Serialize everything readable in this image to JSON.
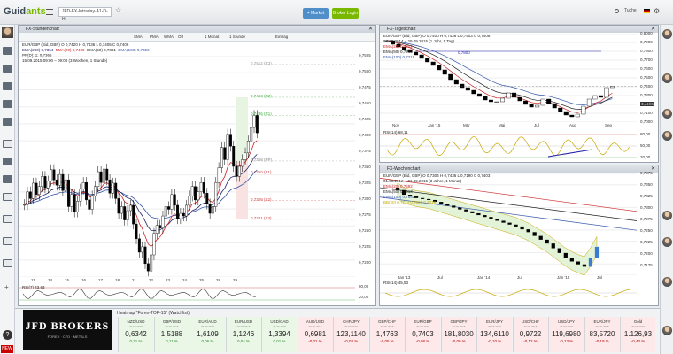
{
  "app": {
    "logo": "Guidants",
    "search_value": "JFD-FX-Intraday-A1-D-H",
    "btn_markt": "+ Market",
    "btn_broker": "Broker Login",
    "profile": "Tuche"
  },
  "chart1": {
    "title": "FX-Stundenchart",
    "toolbar": [
      "SMA",
      "PMA",
      "WMA",
      "Off",
      "1 Monat",
      "1 Stunde",
      "Eintrag"
    ],
    "legend": [
      "EUR/GBP (Bid, GBP)  O 0,7420  H 0,7436  L 0,7405  C 0,7406",
      "EMA(200) 0,7364",
      "EMA(20) 0,7405",
      "EMA(50) 0,7381",
      "EMA(100) 0,7356",
      "PP(D): 1: 0,7366",
      "15.09.2015 09:00 – 09:00 (3 Wochen, 1 Stunde)"
    ],
    "pivots": [
      "0,7512 (R3)",
      "0,7463 (R2)",
      "0,7436 (R1)",
      "0,7368 (PP)",
      "0,7350 (S1)",
      "0,7309 (S2)",
      "0,7281 (S3)"
    ],
    "yticks": [
      "0,7525",
      "0,7500",
      "0,7475",
      "0,7450",
      "0,7425",
      "0,7400",
      "0,7375",
      "0,7350",
      "0,7325",
      "0,7300",
      "0,7275",
      "0,7250",
      "0,7225",
      "0,7200"
    ],
    "xticks": [
      "11",
      "14",
      "15",
      "16",
      "17",
      "18",
      "21",
      "22",
      "23",
      "24",
      "25",
      "28",
      "29"
    ],
    "rsi_label": "RSI(7)  43,63",
    "rsi_ticks": [
      "80,00",
      "20,00"
    ],
    "chart_data": {
      "type": "candlestick",
      "pair": "EUR/GBP",
      "timeframe": "1 Stunde",
      "ylim": [
        0.7195,
        0.7525
      ],
      "close": [
        0.7303,
        0.7322,
        0.7312,
        0.7335,
        0.7318,
        0.733,
        0.7345,
        0.7328,
        0.7338,
        0.7355,
        0.734,
        0.7332,
        0.7348,
        0.7324,
        0.734,
        0.73,
        0.7318,
        0.7292,
        0.7308,
        0.7326,
        0.7336,
        0.731,
        0.7296,
        0.7316,
        0.733,
        0.7352,
        0.7336,
        0.7356,
        0.734,
        0.732,
        0.7335,
        0.7312,
        0.729,
        0.73,
        0.728,
        0.7294,
        0.7302,
        0.7274,
        0.7252,
        0.7232,
        0.724,
        0.7215,
        0.7204,
        0.7228,
        0.726,
        0.7272,
        0.7268,
        0.7286,
        0.73,
        0.7296,
        0.7318,
        0.7302,
        0.7282,
        0.729,
        0.7286,
        0.7302,
        0.7316,
        0.733,
        0.731,
        0.7322,
        0.7336,
        0.732,
        0.7304,
        0.729,
        0.73,
        0.7336,
        0.7358,
        0.7388,
        0.737,
        0.7408,
        0.739,
        0.736,
        0.7345,
        0.736,
        0.737,
        0.738,
        0.7398,
        0.7418,
        0.7436,
        0.741
      ]
    }
  },
  "chart2": {
    "title": "FX-Tageschart",
    "legend": [
      "EUR/GBP (Bid, GBP)  O 0,7400  H 0,7436  L 0,7403  C 0,7406",
      "EMA(20) 0,7302",
      "EMA(50) 0,7263",
      "EMA(100) 0,7219",
      "03.10.2014 – 29.09.2015 (1 Jahr, 1 Tag)"
    ],
    "yticks": [
      "0,8000",
      "0,7900",
      "0,7800",
      "0,7700",
      "0,7600",
      "0,7500",
      "0,7400",
      "0,7300",
      "0,7200",
      "0,7100",
      "0,7000"
    ],
    "price_tag": "0,7406",
    "level": "0,7800",
    "xticks": [
      "Nov",
      "Jan '15",
      "Mär",
      "Mai",
      "Jul",
      "Aug",
      "Sep"
    ],
    "ind_label": "RSI(14) 68,11",
    "ind_ticks": [
      "80,00",
      "50,00",
      "20,00"
    ],
    "chart_data": {
      "type": "line",
      "series": [
        {
          "name": "EUR/GBP",
          "values": [
            0.792,
            0.788,
            0.785,
            0.782,
            0.779,
            0.776,
            0.772,
            0.768,
            0.764,
            0.759,
            0.754,
            0.748,
            0.743,
            0.739,
            0.736,
            0.732,
            0.729,
            0.725,
            0.723,
            0.723,
            0.727,
            0.733,
            0.728,
            0.724,
            0.72,
            0.717,
            0.719,
            0.726,
            0.721,
            0.716,
            0.712,
            0.708,
            0.706,
            0.709,
            0.718,
            0.726,
            0.73,
            0.728,
            0.739,
            0.7406
          ]
        }
      ]
    }
  },
  "chart3": {
    "title": "FX-Wochenchart",
    "legend": [
      "EUR/GBP (Bid, GBP)  O 0,7304  H 0,7436  L 0,7190  C 0,7403",
      "01.09.2012 – 01.09.2015 (3 Jahre, 1 Monat)",
      "EMA(20) 0,7592",
      "EMA(50) 0,7913",
      "EMA(100) 0,7862",
      "BB(20) 0,7713  0,7380  0,7019"
    ],
    "yticks": [
      "0,7375",
      "0,7350",
      "0,7325",
      "0,7300",
      "0,7275",
      "0,7250",
      "0,7225",
      "0,7200",
      "0,7175"
    ],
    "xticks": [
      "Jan '13",
      "Jul",
      "Jan '14",
      "Jul",
      "Jan '15",
      "Jul"
    ],
    "ind_label": "RSI(14) 45,53",
    "chart_data": {
      "type": "candlestick",
      "close": [
        0.7355,
        0.7345,
        0.7342,
        0.7338,
        0.7336,
        0.7334,
        0.733,
        0.7326,
        0.7322,
        0.7318,
        0.7314,
        0.731,
        0.7306,
        0.7302,
        0.7298,
        0.7294,
        0.729,
        0.7286,
        0.7282,
        0.7278,
        0.7272,
        0.7266,
        0.7258,
        0.725,
        0.7242,
        0.7232,
        0.7222,
        0.7212,
        0.7204,
        0.7198,
        0.7193,
        0.7212,
        0.7235
      ]
    }
  },
  "ticker": {
    "header": "Heatmap \"Forex-TOP-15\" (Watchlist)",
    "broker_name": "JFD BROKERS",
    "broker_tagline": "FOREX · CFD · METALS",
    "items": [
      {
        "pair": "NZD/USD",
        "sub": "29.09.2015",
        "value": "0,6342",
        "chg": "0,31 %"
      },
      {
        "pair": "GBP/USD",
        "sub": "29.09.2015",
        "value": "1,5188",
        "chg": "0,11 %"
      },
      {
        "pair": "EUR/AUD",
        "sub": "29.09.2015",
        "value": "1,6109",
        "chg": "0,06 %"
      },
      {
        "pair": "EUR/USD",
        "sub": "29.09.2015",
        "value": "1,1246",
        "chg": "0,04 %"
      },
      {
        "pair": "USD/CAD",
        "sub": "29.09.2015",
        "value": "1,3394",
        "chg": "0,01 %"
      },
      {
        "pair": "AUD/USD",
        "sub": "29.09.2015",
        "value": "0,6981",
        "chg": "-0,01 %"
      },
      {
        "pair": "CHF/JPY",
        "sub": "29.09.2015",
        "value": "123,1140",
        "chg": "-0,03 %"
      },
      {
        "pair": "GBP/CHF",
        "sub": "29.09.2015",
        "value": "1,4763",
        "chg": "-0,05 %"
      },
      {
        "pair": "EUR/GBP",
        "sub": "29.09.2015",
        "value": "0,7403",
        "chg": "-0,08 %"
      },
      {
        "pair": "GBP/JPY",
        "sub": "29.09.2015",
        "value": "181,8030",
        "chg": "-0,09 %"
      },
      {
        "pair": "EUR/JPY",
        "sub": "29.09.2015",
        "value": "134,6110",
        "chg": "-0,10 %"
      },
      {
        "pair": "USD/CHF",
        "sub": "29.09.2015",
        "value": "0,9722",
        "chg": "-0,12 %"
      },
      {
        "pair": "USD/JPY",
        "sub": "29.09.2015",
        "value": "119,6980",
        "chg": "-0,13 %"
      },
      {
        "pair": "EUR/JPY",
        "sub": "29.09.2015",
        "value": "83,5720",
        "chg": "-0,19 %"
      },
      {
        "pair": "Gold",
        "sub": "29.09.2015",
        "value": "1.126,93",
        "chg": "-0,43 %"
      }
    ]
  },
  "colors": {
    "up": "#000000",
    "down": "#111111",
    "ema20": "#cc2222",
    "ema50": "#222266",
    "ema100": "#3355aa",
    "rsi": "#c8a800",
    "bb": "#dd0000"
  }
}
